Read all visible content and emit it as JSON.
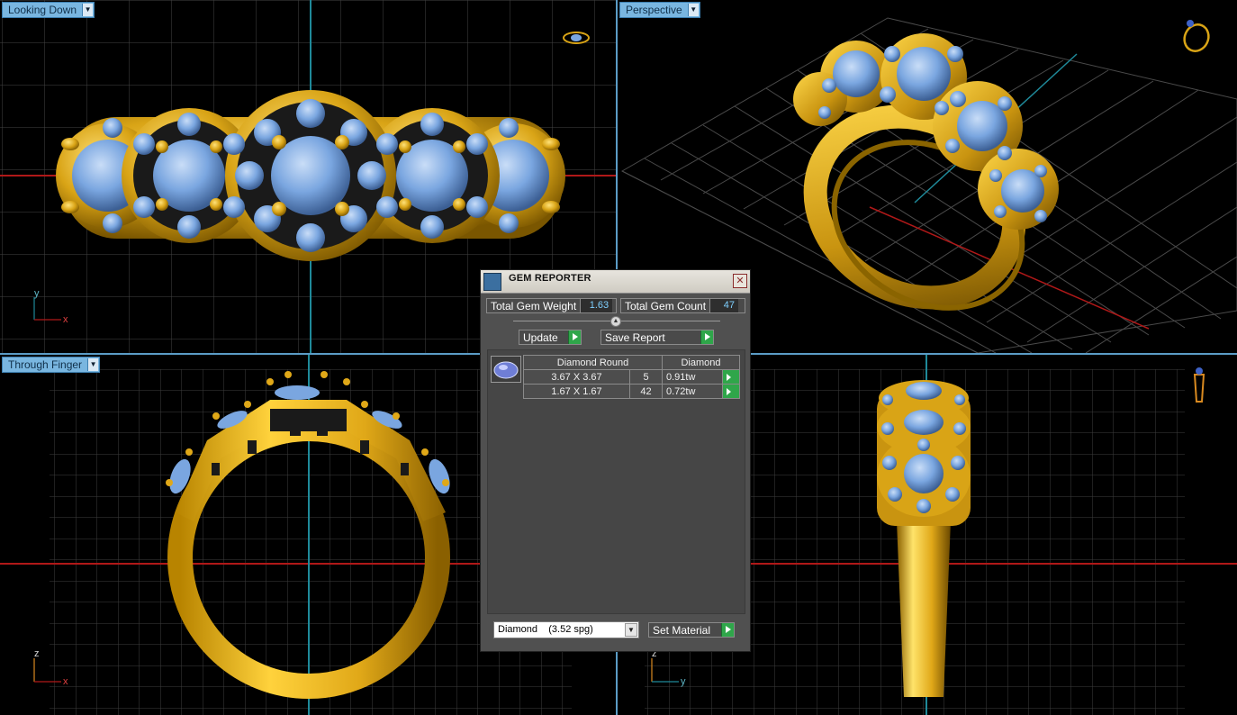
{
  "viewports": {
    "top_left": {
      "label": "Looking Down"
    },
    "top_right": {
      "label": "Perspective"
    },
    "bottom_left": {
      "label": "Through Finger"
    },
    "bottom_right": {
      "label": ""
    }
  },
  "axes": {
    "top_left": {
      "v": "y",
      "h": "x"
    },
    "bottom_left": {
      "v": "z",
      "h": "x"
    },
    "bottom_right": {
      "v": "z",
      "h": "y"
    }
  },
  "panel": {
    "title": "GEM REPORTER",
    "total_weight_label": "Total Gem Weight",
    "total_weight_value": "1.63",
    "total_count_label": "Total Gem Count",
    "total_count_value": "47",
    "update_label": "Update",
    "save_report_label": "Save Report",
    "table": {
      "headers": [
        "Diamond Round",
        "Diamond"
      ],
      "rows": [
        {
          "size": "3.67 X 3.67",
          "count": "5",
          "weight": "0.91tw"
        },
        {
          "size": "1.67 X 1.67",
          "count": "42",
          "weight": "0.72tw"
        }
      ]
    },
    "material_select": "Diamond    (3.52 spg)",
    "set_material_label": "Set Material"
  },
  "colors": {
    "gold": "#d9a416",
    "gem": "#7aa6e0",
    "grid": "#4a4a4a",
    "axis_red": "#b01818",
    "axis_teal": "#1f8a9a"
  }
}
